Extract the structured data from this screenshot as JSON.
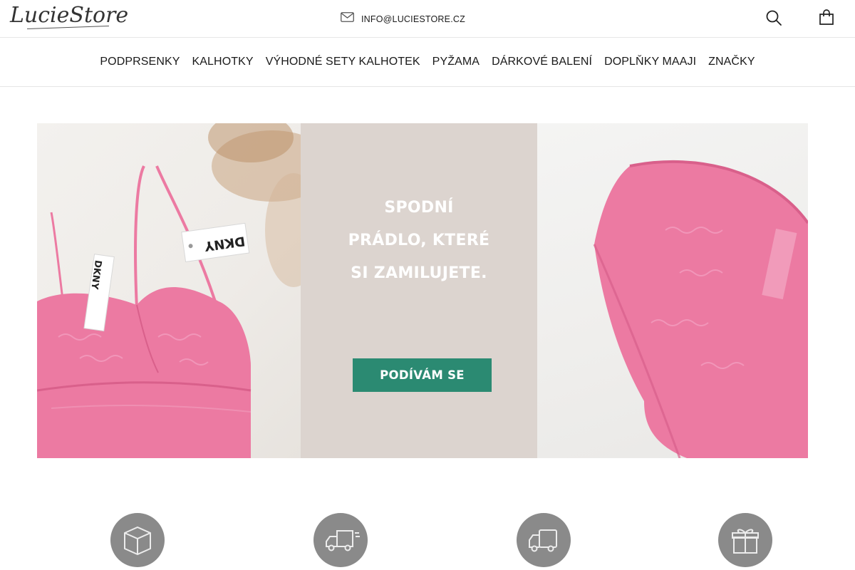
{
  "header": {
    "logo_text": "LucieStore",
    "contact_email": "INFO@LUCIESTORE.CZ",
    "icons": {
      "mail": "mail-icon",
      "search": "search-icon",
      "cart": "cart-icon"
    }
  },
  "nav": {
    "items": [
      {
        "label": "PODPRSENKY"
      },
      {
        "label": "KALHOTKY"
      },
      {
        "label": "VÝHODNÉ SETY KALHOTEK"
      },
      {
        "label": "PYŽAMA"
      },
      {
        "label": "DÁRKOVÉ BALENÍ"
      },
      {
        "label": "DOPLŇKY MAAJI"
      },
      {
        "label": "ZNAČKY"
      }
    ]
  },
  "hero": {
    "headline_lines": [
      "SPODNÍ",
      "PRÁDLO, KTERÉ",
      "SI ZAMILUJETE."
    ],
    "cta_label": "PODÍVÁM SE",
    "tag_brand": "DKNY",
    "colors": {
      "panel": "#dcd4cf",
      "cta": "#2b8a72",
      "garment": "#ec7aa2"
    }
  },
  "features": {
    "icons": [
      "package-icon",
      "delivery-truck-icon",
      "truck-icon",
      "gift-icon"
    ],
    "color": "#8a8a8a"
  }
}
